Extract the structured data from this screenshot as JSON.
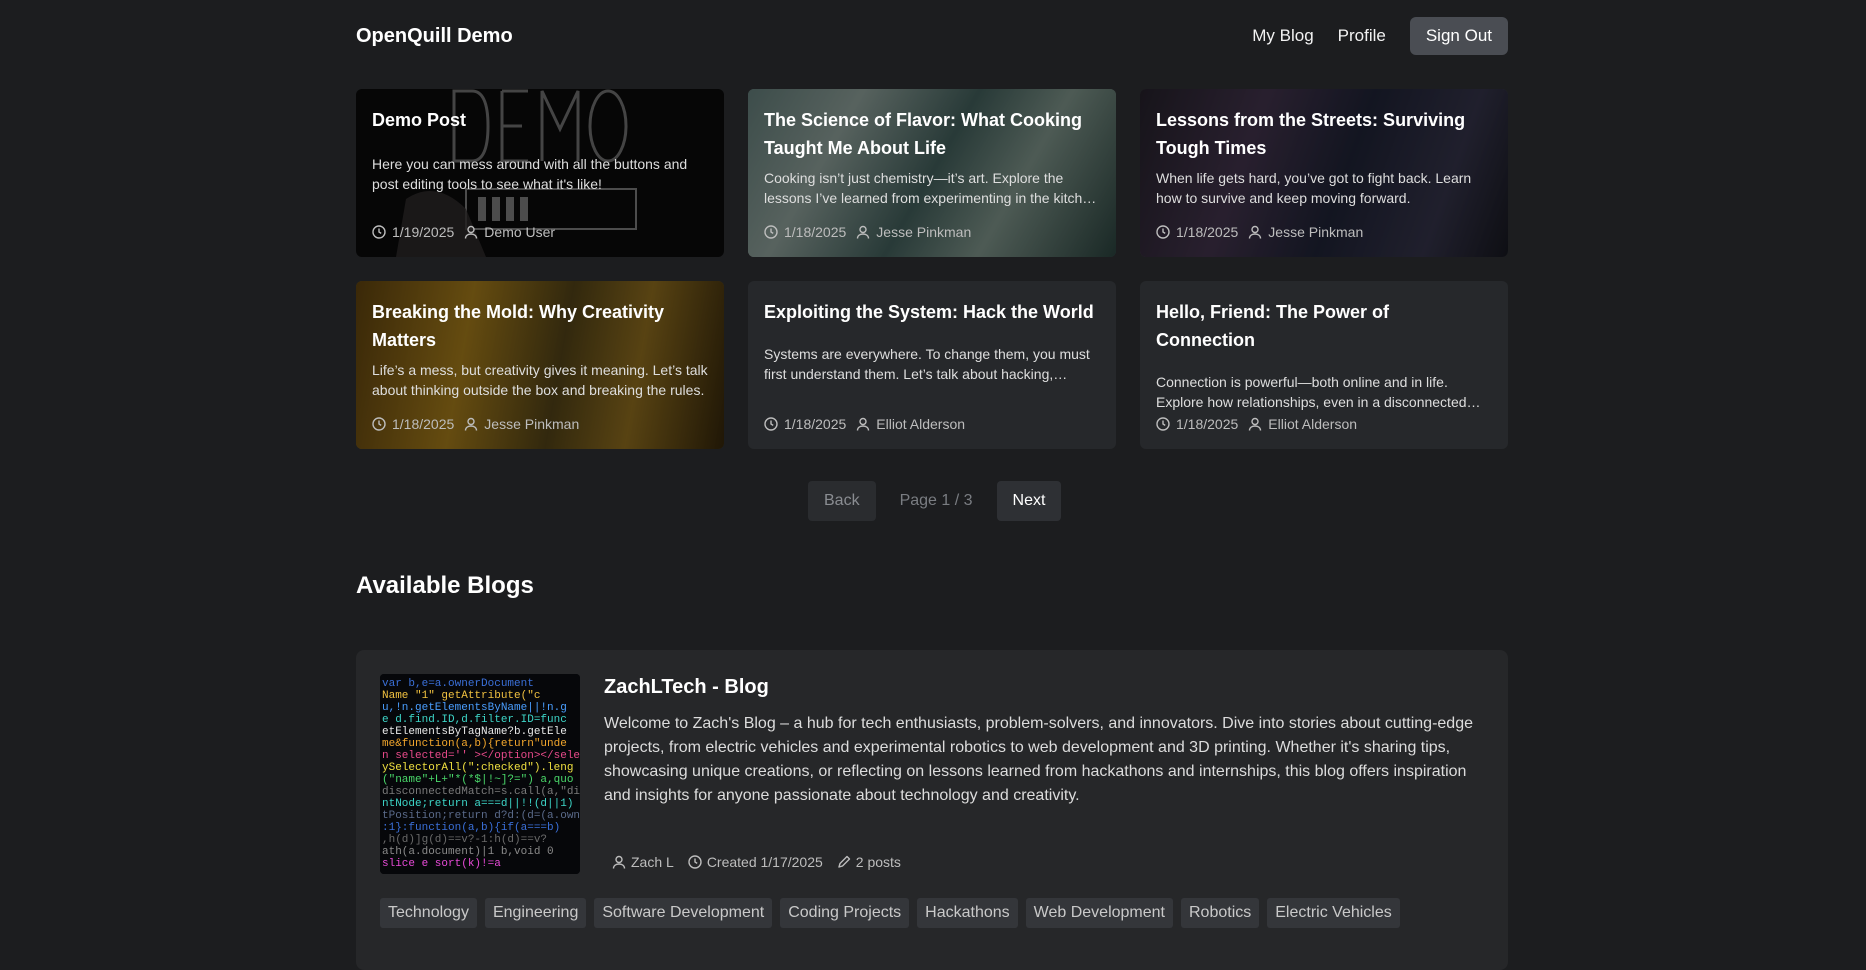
{
  "header": {
    "brand": "OpenQuill Demo",
    "nav": [
      "My Blog",
      "Profile"
    ],
    "sign_out": "Sign Out"
  },
  "posts": [
    {
      "title": "Demo Post",
      "excerpt": "Here you can mess around with all the buttons and post editing tools to see what it's like!",
      "date": "1/19/2025",
      "author": "Demo User"
    },
    {
      "title": "The Science of Flavor: What Cooking Taught Me About Life",
      "excerpt": "Cooking isn’t just chemistry—it’s art. Explore the lessons I’ve learned from experimenting in the kitchen and beyond.",
      "date": "1/18/2025",
      "author": "Jesse Pinkman"
    },
    {
      "title": "Lessons from the Streets: Surviving Tough Times",
      "excerpt": "When life gets hard, you’ve got to fight back. Learn how to survive and keep moving forward.",
      "date": "1/18/2025",
      "author": "Jesse Pinkman"
    },
    {
      "title": "Breaking the Mold: Why Creativity Matters",
      "excerpt": "Life’s a mess, but creativity gives it meaning. Let’s talk about thinking outside the box and breaking the rules.",
      "date": "1/18/2025",
      "author": "Jesse Pinkman"
    },
    {
      "title": "Exploiting the System: Hack the World",
      "excerpt": "Systems are everywhere. To change them, you must first understand them. Let’s talk about hacking, control, and freedom.",
      "date": "1/18/2025",
      "author": "Elliot Alderson"
    },
    {
      "title": "Hello, Friend: The Power of Connection",
      "excerpt": "Connection is powerful—both online and in life. Explore how relationships, even in a disconnected world, shape who we are.",
      "date": "1/18/2025",
      "author": "Elliot Alderson"
    }
  ],
  "pagination": {
    "back": "Back",
    "info": "Page 1 / 3",
    "next": "Next"
  },
  "blogs_heading": "Available Blogs",
  "blog": {
    "title": "ZachLTech - Blog",
    "description": "Welcome to Zach's Blog – a hub for tech enthusiasts, problem-solvers, and innovators. Dive into stories about cutting-edge projects, from electric vehicles and experimental robotics to web development and 3D printing. Whether it's sharing tips, showcasing unique creations, or reflecting on lessons learned from hackathons and internships, this blog offers inspiration and insights for anyone passionate about technology and creativity.",
    "author": "Zach L",
    "created": "Created 1/17/2025",
    "posts": "2 posts",
    "tags": [
      "Technology",
      "Engineering",
      "Software Development",
      "Coding Projects",
      "Hackathons",
      "Web Development",
      "Robotics",
      "Electric Vehicles"
    ]
  },
  "colors": {
    "background": "#1c1d1f",
    "card": "#26282b",
    "sign_out_bg": "#4a4d53"
  },
  "icons": [
    "clock-icon",
    "user-icon",
    "pencil-icon"
  ]
}
